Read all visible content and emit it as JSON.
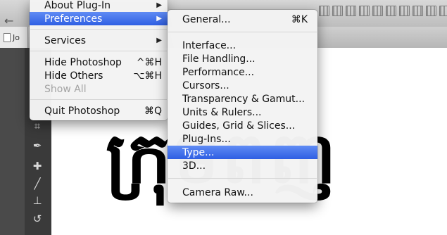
{
  "doc_tab": {
    "label": "Jo"
  },
  "app_menu": {
    "items": [
      {
        "label": "About Plug-In",
        "submenu": true
      },
      {
        "label": "Preferences",
        "submenu": true,
        "highlighted": true
      },
      {
        "label": "Services",
        "submenu": true
      },
      {
        "label": "Hide Photoshop",
        "shortcut": "^⌘H"
      },
      {
        "label": "Hide Others",
        "shortcut": "⌥⌘H"
      },
      {
        "label": "Show All",
        "disabled": true
      },
      {
        "label": "Quit Photoshop",
        "shortcut": "⌘Q"
      }
    ]
  },
  "prefs_menu": {
    "items": [
      {
        "label": "General...",
        "shortcut": "⌘K"
      },
      {
        "label": "Interface..."
      },
      {
        "label": "File Handling..."
      },
      {
        "label": "Performance..."
      },
      {
        "label": "Cursors..."
      },
      {
        "label": "Transparency & Gamut..."
      },
      {
        "label": "Units & Rulers..."
      },
      {
        "label": "Guides, Grid & Slices..."
      },
      {
        "label": "Plug-Ins..."
      },
      {
        "label": "Type...",
        "highlighted": true
      },
      {
        "label": "3D..."
      },
      {
        "label": "Camera Raw..."
      }
    ]
  },
  "canvas": {
    "text": "ក្រុមពញ"
  },
  "colors": {
    "highlight": "#2f5fe3",
    "menu_bg": "#f3f3f3"
  },
  "icons": [
    "back-arrow-icon",
    "chevron-right-icon",
    "file-icon",
    "crop-icon",
    "eyedropper-icon",
    "healing-brush-icon",
    "brush-icon",
    "stamp-icon",
    "history-brush-icon"
  ]
}
